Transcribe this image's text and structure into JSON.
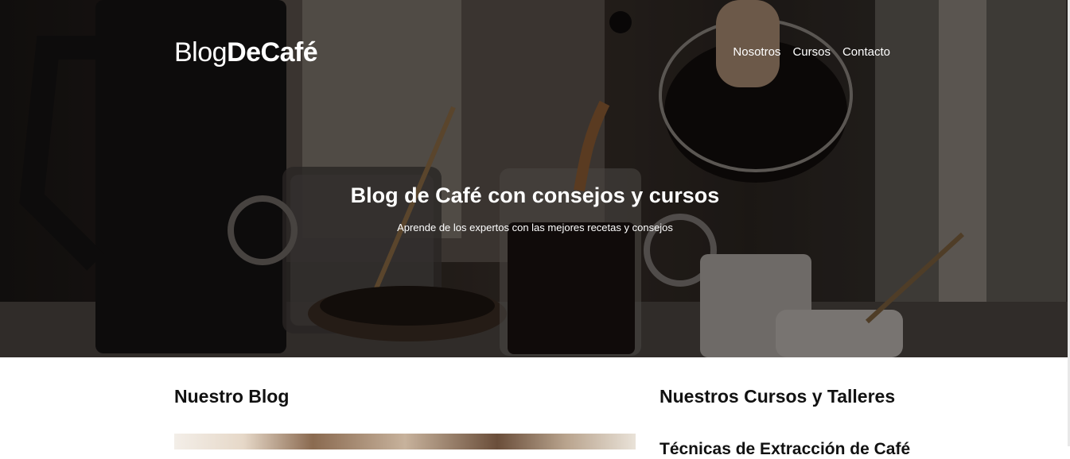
{
  "header": {
    "logo_light": "Blog",
    "logo_bold": "DeCafé"
  },
  "nav": {
    "items": [
      "Nosotros",
      "Cursos",
      "Contacto"
    ]
  },
  "hero": {
    "title": "Blog de Café con consejos y cursos",
    "subtitle": "Aprende de los expertos con las mejores recetas y consejos"
  },
  "blog": {
    "heading": "Nuestro Blog"
  },
  "courses": {
    "heading": "Nuestros Cursos y Talleres",
    "first_course_title": "Técnicas de Extracción de Café"
  }
}
